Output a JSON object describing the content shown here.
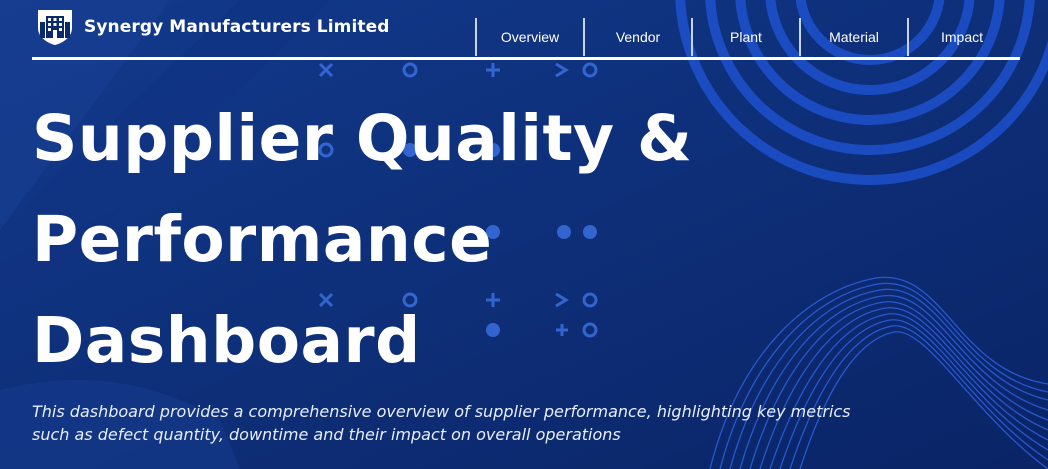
{
  "header": {
    "company_name": "Synergy Manufacturers Limited",
    "logo_icon": "building-shield-icon"
  },
  "nav": {
    "items": [
      {
        "label": "Overview"
      },
      {
        "label": "Vendor"
      },
      {
        "label": "Plant"
      },
      {
        "label": "Material"
      },
      {
        "label": "Impact"
      }
    ]
  },
  "hero": {
    "title_line1": "Supplier Quality &",
    "title_line2": "Performance",
    "title_line3": "Dashboard",
    "subtitle": "This dashboard provides a comprehensive overview of supplier performance, highlighting key metrics such as defect quantity, downtime and their impact on overall operations"
  },
  "colors": {
    "background": "#0b2a6e",
    "accent_blue": "#1a4fd6",
    "text": "#ffffff"
  }
}
